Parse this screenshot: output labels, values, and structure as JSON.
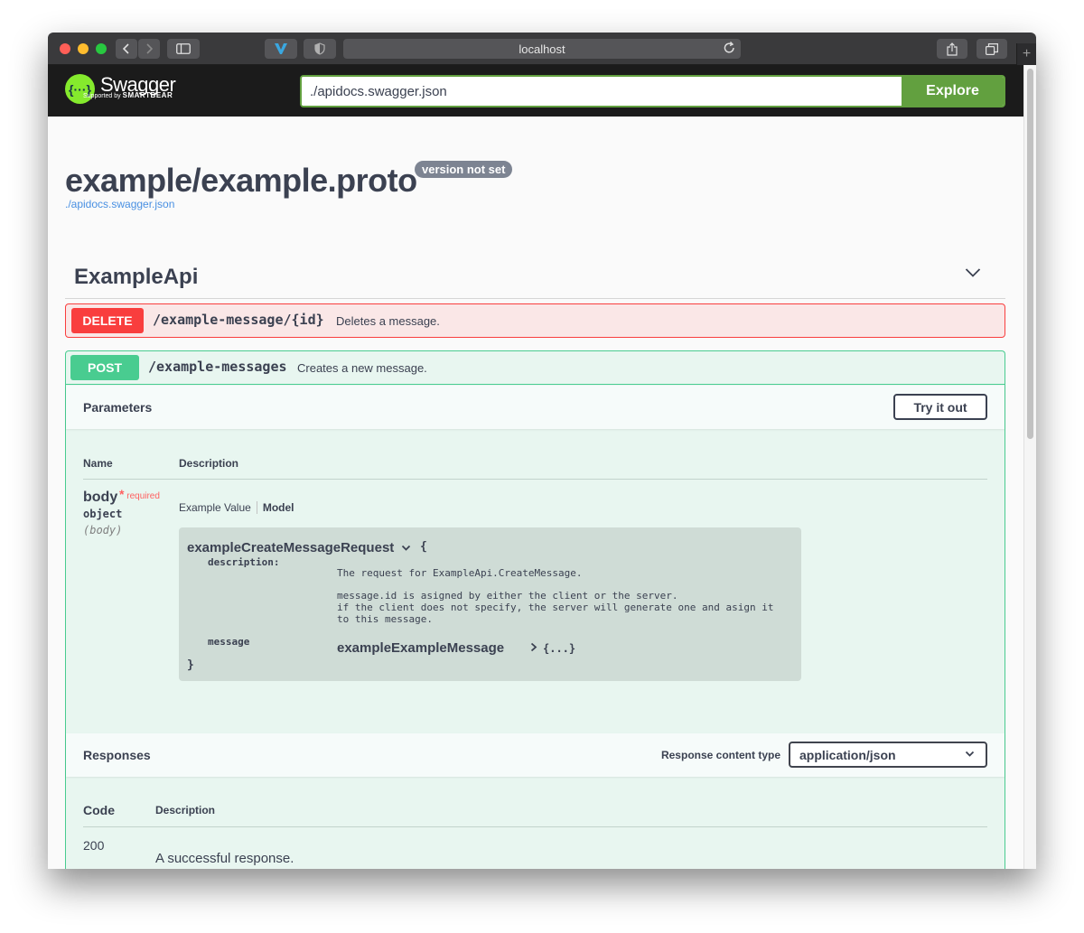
{
  "browser": {
    "address": "localhost",
    "colors": {
      "close": "#ff5f57",
      "minimize": "#febc2e",
      "maximize": "#28c840"
    }
  },
  "topbar": {
    "logo_text": "Swagger",
    "logo_sub_prefix": "Supported by",
    "logo_sub_brand": "SMARTBEAR",
    "url_value": "./apidocs.swagger.json",
    "explore_label": "Explore"
  },
  "info": {
    "title": "example/example.proto",
    "version_badge": "version not set",
    "spec_link": "./apidocs.swagger.json"
  },
  "tag": {
    "name": "ExampleApi"
  },
  "operations": {
    "delete": {
      "method": "DELETE",
      "path": "/example-message/{id}",
      "summary": "Deletes a message.",
      "color": "#f93e3e"
    },
    "post": {
      "method": "POST",
      "path": "/example-messages",
      "summary": "Creates a new message.",
      "color": "#49cc90"
    }
  },
  "parameters": {
    "title": "Parameters",
    "try_label": "Try it out",
    "col_name": "Name",
    "col_description": "Description",
    "param": {
      "name": "body",
      "required_mark": "*",
      "required_label": "required",
      "type": "object",
      "in": "(body)"
    },
    "tabs": {
      "example": "Example Value",
      "model": "Model"
    },
    "model": {
      "title": "exampleCreateMessageRequest",
      "open_brace": "{",
      "close_brace": "}",
      "desc_key": "description:",
      "desc_line1": "The request for ExampleApi.CreateMessage.",
      "desc_line2": "message.id is asigned by either the client or the server.\nif the client does not specify, the server will generate one and asign it\nto this message.",
      "message_key": "message",
      "message_ref": "exampleExampleMessage",
      "message_collapsed": "{...}"
    }
  },
  "responses": {
    "title": "Responses",
    "content_type_label": "Response content type",
    "content_type_value": "application/json",
    "col_code": "Code",
    "col_description": "Description",
    "rows": [
      {
        "code": "200",
        "description": "A successful response."
      }
    ]
  }
}
